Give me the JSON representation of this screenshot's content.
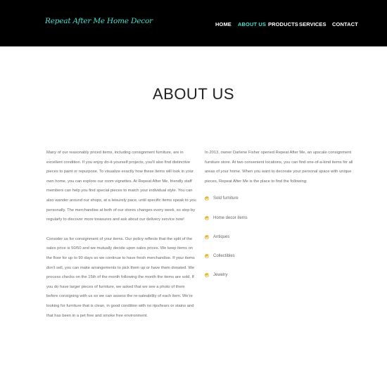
{
  "header": {
    "logo": "Repeat After Me Home Decor",
    "nav": [
      "HOME",
      "ABOUT US",
      "PRODUCTS",
      "SERVICES",
      "CONTACT"
    ],
    "active_index": 1
  },
  "colors": {
    "accent": "#40e0d0",
    "header_bg": "#000000",
    "bullet": "#e8b63a"
  },
  "main": {
    "title": "ABOUT US",
    "left_paragraphs": [
      "Many of our reasonably priced items, including consignment furniture, are in excellent condition. If you enjoy do-it-yourself projects, you'll also find distinctive pieces to paint or repurpose. To visualize exactly how these items will look in your own home, you can explore our room vignettes. At Repeat After Me, friendly staff members can help you find special pieces to match your individual style. You can also wander around our shops, at a leisurely pace, until specific items speak to you personally. The merchandise at both of our stores changes every week, so stop by regularly to discover more treasures and ask about our delivery service now!",
      "Consider us for consignment of your items. Our policy reflects that the split of the sales price is 50/50 and we mutually decide upon sales prices. We keep items on the floor for up to 90 days so we continue to have fresh merchandise. If your items don't sell, you can make arrangements to pick them up or have them donated. We process checks on the 15th of the month following the month the items are sold. If you do have larger pieces of furniture, we asked that we see a photo of them before consigning with us so we can assess the re-saleability of each item. We're looking for furniture that is clean, in good condition with no rips/tears or stains and that has been in a pet free and smoke free environment."
    ],
    "right_intro": "In 2013, owner Darlene Fisher opened Repeat After Me, an upscale consignment furniture store. At two convenient locations, you can find one-of-a-kind items for all areas of your home. When you want to decorate your personal space with unique pieces, Repeat After Me is the place to find the following:",
    "list_icon": "check-circle-icon",
    "list_items": [
      "Sold furniture",
      "Home decor items",
      "Antiques",
      "Collectibles",
      "Jewelry"
    ]
  }
}
